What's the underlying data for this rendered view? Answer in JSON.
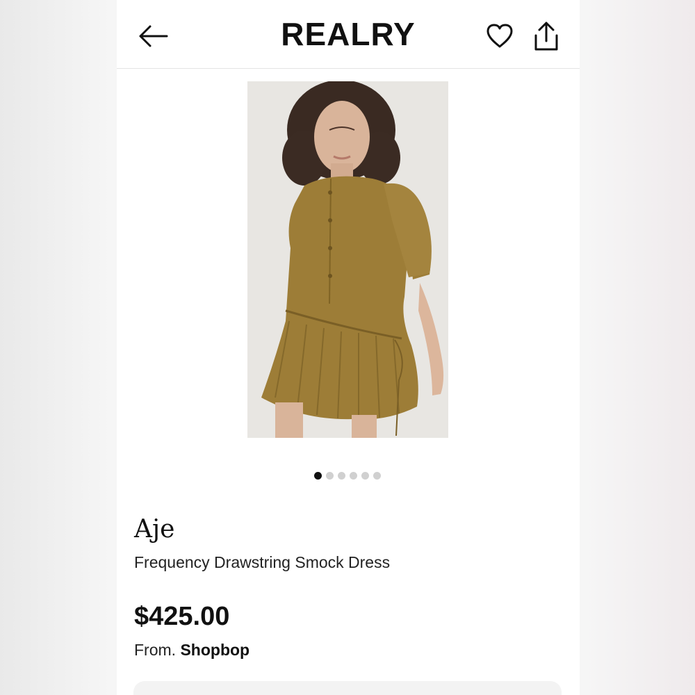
{
  "header": {
    "logo": "REALRY",
    "icons": [
      "back-arrow-icon",
      "heart-icon",
      "share-icon"
    ]
  },
  "gallery": {
    "image_count": 6,
    "active_index": 0,
    "image_description": "Model wearing olive smock dress"
  },
  "product": {
    "brand": "Aje",
    "name": "Frequency Drawstring Smock Dress",
    "price": "$425.00",
    "from_label": "From.",
    "seller": "Shopbop"
  },
  "colors": {
    "dress": "#9a7b35",
    "text": "#111111",
    "divider": "#e3e3e3"
  }
}
